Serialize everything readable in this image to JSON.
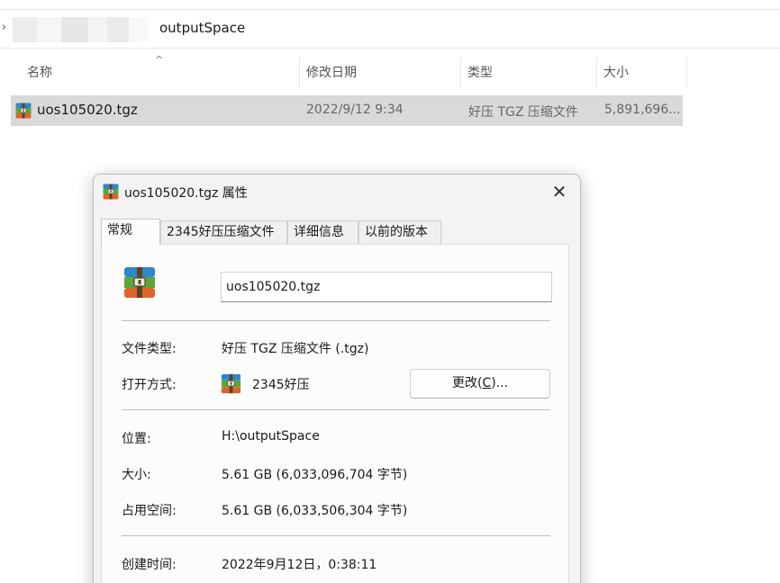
{
  "explorer": {
    "breadcrumb": "outputSpace",
    "columns": {
      "name": "名称",
      "modified": "修改日期",
      "type": "类型",
      "size": "大小"
    },
    "file": {
      "name": "uos105020.tgz",
      "modified": "2022/9/12 9:34",
      "type": "好压 TGZ 压缩文件",
      "size": "5,891,696..."
    }
  },
  "dialog": {
    "title": "uos105020.tgz 属性",
    "tabs": [
      "常规",
      "2345好压压缩文件",
      "详细信息",
      "以前的版本"
    ],
    "active_tab": "常规",
    "filename": "uos105020.tgz",
    "rows": {
      "file_type": {
        "label": "文件类型:",
        "value": "好压 TGZ 压缩文件 (.tgz)"
      },
      "open_with": {
        "label": "打开方式:",
        "value": "2345好压"
      },
      "change_button": {
        "prefix": "更改(",
        "key": "C",
        "suffix": ")..."
      },
      "location": {
        "label": "位置:",
        "value": "H:\\outputSpace"
      },
      "size": {
        "label": "大小:",
        "value": "5.61 GB (6,033,096,704 字节)"
      },
      "size_on_disk": {
        "label": "占用空间:",
        "value": "5.61 GB (6,033,506,304 字节)"
      },
      "created": {
        "label": "创建时间:",
        "value": "2022年9月12日，0:38:11"
      }
    }
  },
  "colors": {
    "selection": "#d9d9d9",
    "dialog_bg": "#f3f3f3",
    "archive_blue": "#2f86c9",
    "archive_green": "#5aa83a",
    "archive_orange": "#e0632c"
  }
}
